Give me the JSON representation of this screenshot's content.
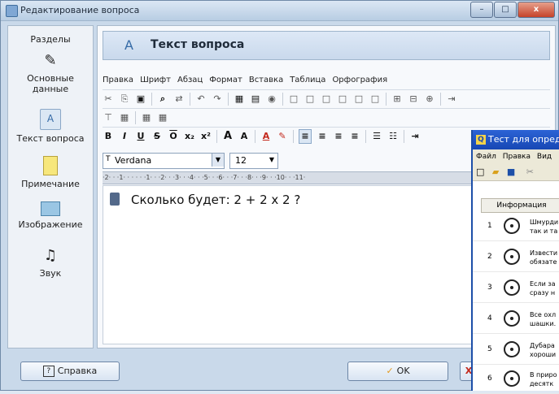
{
  "window": {
    "title": "Редактирование вопроса",
    "buttons": [
      "–",
      "□",
      "x"
    ]
  },
  "sidebar": {
    "header": "Разделы",
    "items": [
      {
        "label": "Основные данные",
        "icon": "pencil-icon"
      },
      {
        "label": "Текст вопроса",
        "icon": "text-question-icon"
      },
      {
        "label": "Примечание",
        "icon": "note-icon"
      },
      {
        "label": "Изображение",
        "icon": "image-icon"
      },
      {
        "label": "Звук",
        "icon": "music-note-icon"
      }
    ]
  },
  "main": {
    "heading": "Текст вопроса",
    "menu": [
      "Правка",
      "Шрифт",
      "Абзац",
      "Формат",
      "Вставка",
      "Таблица",
      "Орфография"
    ],
    "font": {
      "name": "Verdana",
      "size": "12"
    },
    "ruler": "·2· · ·1· · · · · ·1· · ·2· · ·3· · ·4· · ·5· · ·6· · ·7· · ·8· · ·9· · ·10· · ·11·",
    "editor_text": "Сколько будет: 2 + 2 x 2 ?"
  },
  "bottom": {
    "help": "Справка",
    "ok": "OK"
  },
  "overlay_window": {
    "title": "Тест для опред",
    "menu": [
      "Файл",
      "Правка",
      "Вид"
    ],
    "column_header": "Информация",
    "rows": [
      {
        "n": "1",
        "text1": "Шмурди",
        "text2": "так и та"
      },
      {
        "n": "2",
        "text1": "Извести",
        "text2": "обязате"
      },
      {
        "n": "3",
        "text1": "Если за",
        "text2": "сразу н"
      },
      {
        "n": "4",
        "text1": "Все охл",
        "text2": "шашки."
      },
      {
        "n": "5",
        "text1": "Дубара",
        "text2": "хороши"
      },
      {
        "n": "6",
        "text1": "В приро",
        "text2": "десятк"
      }
    ]
  }
}
